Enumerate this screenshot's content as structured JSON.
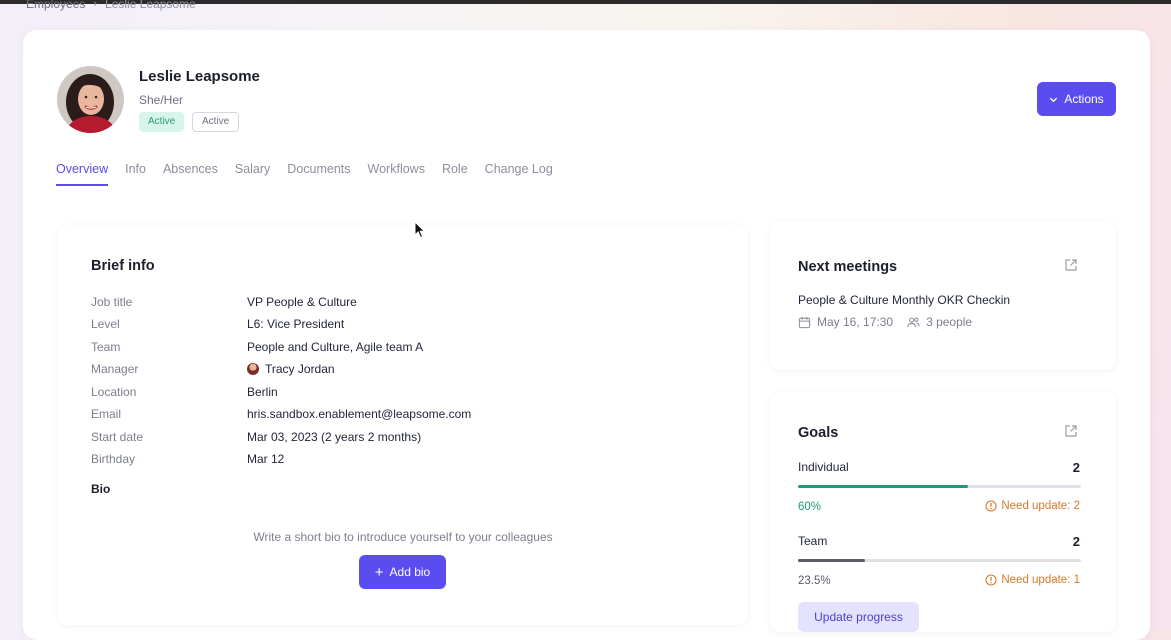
{
  "breadcrumb": {
    "root": "Employees",
    "current": "Leslie Leapsome"
  },
  "employee": {
    "name": "Leslie Leapsome",
    "pronouns": "She/Her",
    "badges": [
      "Active",
      "Active"
    ]
  },
  "header": {
    "actions_label": "Actions"
  },
  "tabs": [
    {
      "label": "Overview",
      "active": true
    },
    {
      "label": "Info"
    },
    {
      "label": "Absences"
    },
    {
      "label": "Salary"
    },
    {
      "label": "Documents"
    },
    {
      "label": "Workflows"
    },
    {
      "label": "Role"
    },
    {
      "label": "Change Log"
    }
  ],
  "brief_info": {
    "title": "Brief info",
    "rows": [
      {
        "label": "Job title",
        "value": "VP People & Culture"
      },
      {
        "label": "Level",
        "value": "L6: Vice President"
      },
      {
        "label": "Team",
        "value": "People and Culture, Agile team A"
      },
      {
        "label": "Manager",
        "value": "Tracy Jordan"
      },
      {
        "label": "Location",
        "value": "Berlin"
      },
      {
        "label": "Email",
        "value": "hris.sandbox.enablement@leapsome.com"
      },
      {
        "label": "Start date",
        "value": "Mar 03, 2023 (2 years 2 months)"
      },
      {
        "label": "Birthday",
        "value": "Mar 12"
      }
    ],
    "bio_label": "Bio",
    "bio_hint": "Write a short bio to introduce yourself to your colleagues",
    "add_bio_label": "Add bio"
  },
  "next_meetings": {
    "title": "Next meetings",
    "meeting": {
      "title": "People & Culture Monthly OKR Checkin",
      "date": "May 16, 17:30",
      "attendees": "3 people"
    }
  },
  "goals": {
    "title": "Goals",
    "items": [
      {
        "name": "Individual",
        "count": "2",
        "percent": "60%",
        "progress": 0.6,
        "warning": "Need update: 2",
        "color": "#1f9a78"
      },
      {
        "name": "Team",
        "count": "2",
        "percent": "23.5%",
        "progress": 0.235,
        "warning": "Need update: 1",
        "color": "#5a5c66"
      }
    ],
    "update_label": "Update progress"
  },
  "colors": {
    "accent": "#5b4cf0",
    "success": "#1f9a78",
    "warning": "#d8782a"
  }
}
